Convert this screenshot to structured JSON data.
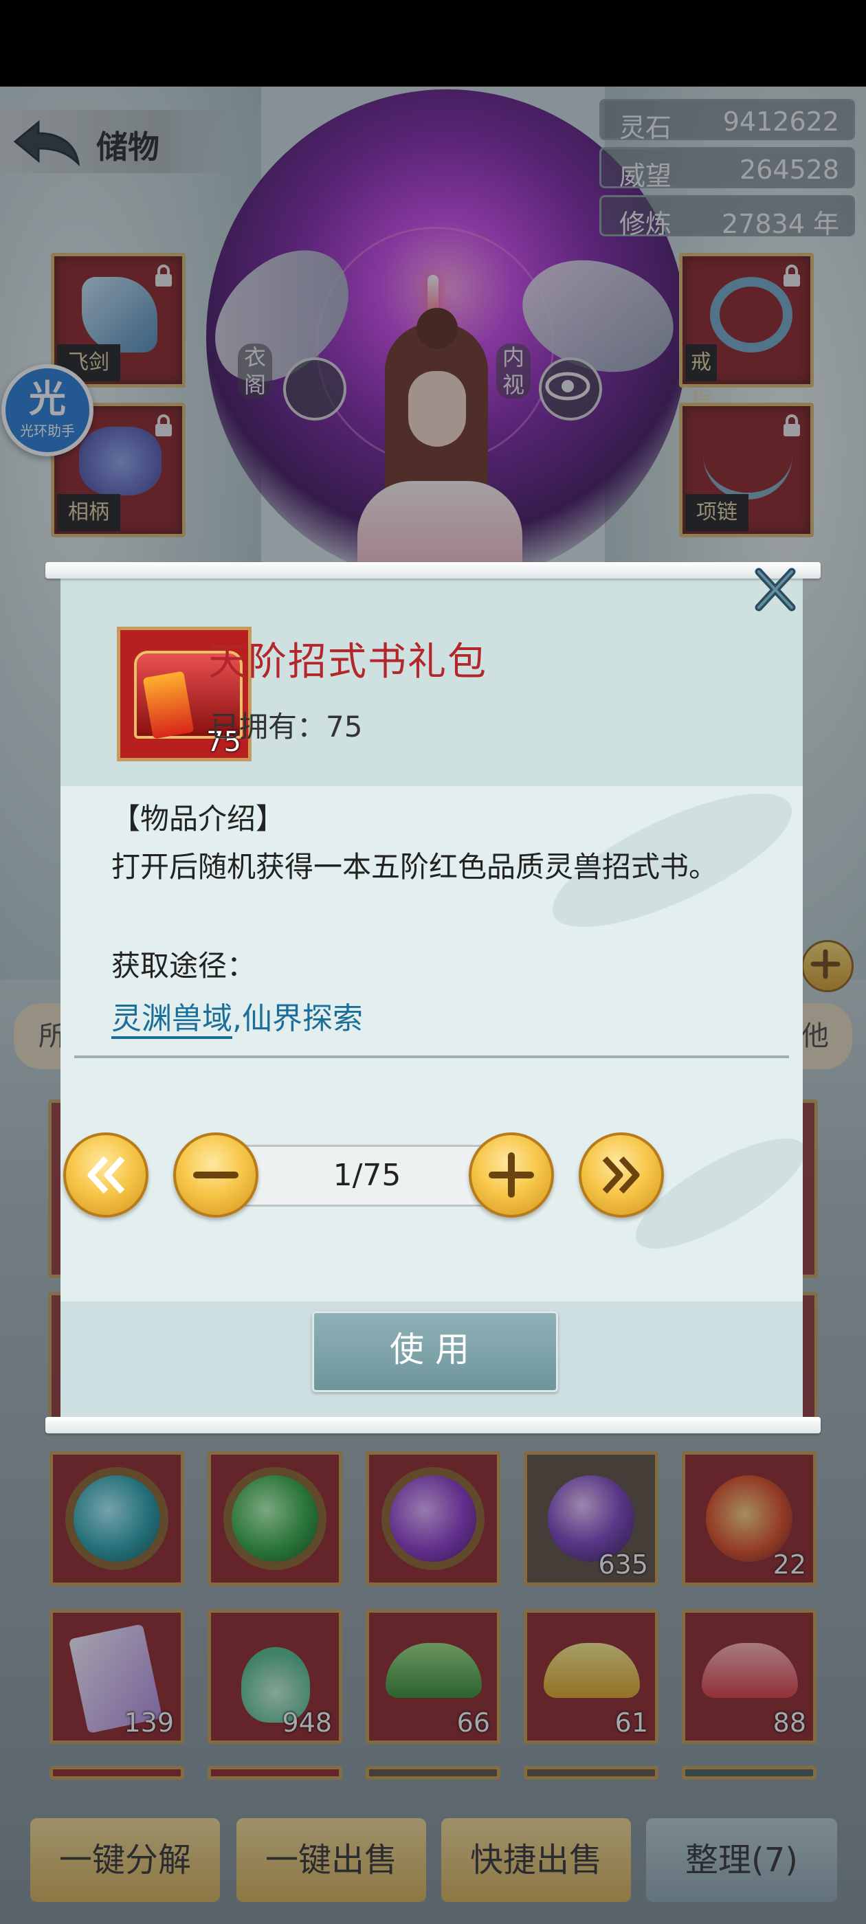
{
  "header": {
    "title": "储物"
  },
  "stats": [
    {
      "label": "灵石",
      "value": "9412622"
    },
    {
      "label": "威望",
      "value": "264528"
    },
    {
      "label": "修炼",
      "value": "27834 年"
    }
  ],
  "equip_seals": {
    "slot1": "飞剑",
    "slot2": "相柄",
    "slot3": "戒指",
    "slot4": "项链"
  },
  "side_buttons": {
    "left": "衣阁",
    "right": "内视"
  },
  "float_helper": {
    "char": "光",
    "label": "光环助手"
  },
  "tabs": {
    "left_partial": "所",
    "right_partial": "他"
  },
  "dialog": {
    "item_name": "天阶招式书礼包",
    "icon_count": "75",
    "owned_label": "已拥有：",
    "owned_value": "75",
    "section_title": "【物品介绍】",
    "description": "打开后随机获得一本五阶红色品质灵兽招式书。",
    "source_title": "获取途径：",
    "source_link_1": "灵渊兽域",
    "source_sep": ",",
    "source_link_2": "仙界探索",
    "quantity": "1/75",
    "use_label": "使用"
  },
  "grid_counts": {
    "r1": [
      "",
      "",
      "",
      "635",
      "22"
    ],
    "r2": [
      "139",
      "948",
      "66",
      "61",
      "88"
    ]
  },
  "bottom_buttons": [
    "一键分解",
    "一键出售",
    "快捷出售",
    "整理(7)"
  ],
  "colors": {
    "accent_red": "#b3262a",
    "link_blue": "#1c6e9a",
    "gold": "#f7c74a"
  }
}
